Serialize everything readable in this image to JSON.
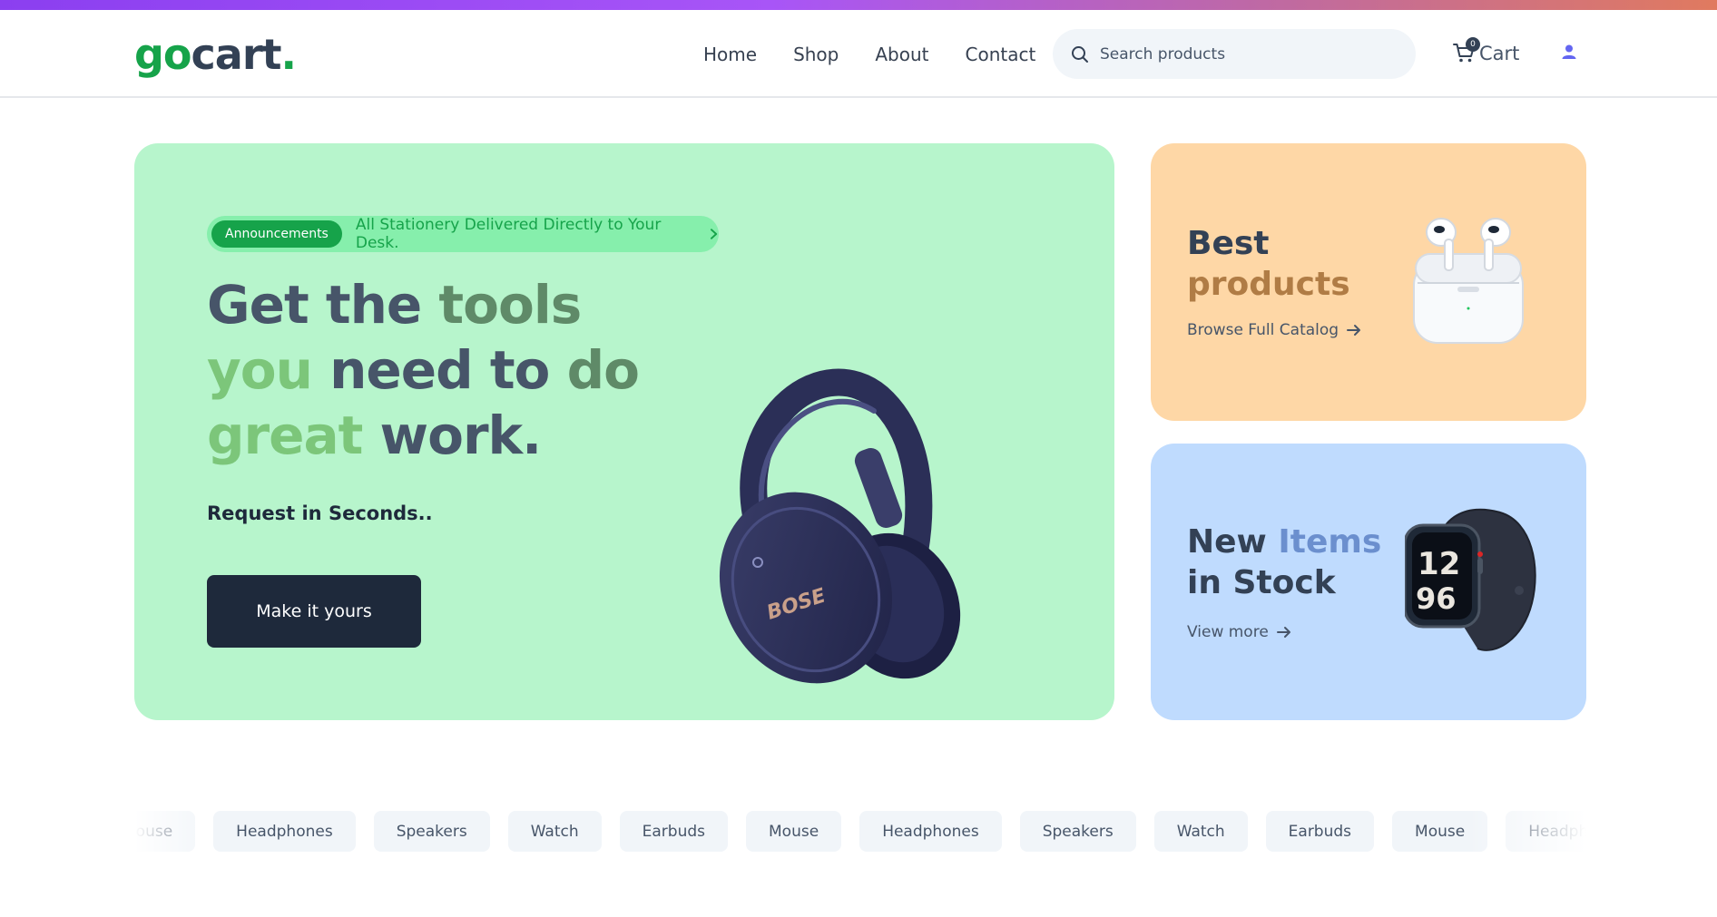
{
  "brand": {
    "logo_go": "go",
    "logo_cart": "cart",
    "logo_dot": ".",
    "accent_color": "#16a34a"
  },
  "nav": {
    "links": [
      "Home",
      "Shop",
      "About",
      "Contact"
    ],
    "search_placeholder": "Search products",
    "cart_label": "Cart",
    "cart_count": "0",
    "icons": {
      "search": "search-icon",
      "cart": "cart-icon",
      "user": "user-icon"
    }
  },
  "hero": {
    "announcement_badge": "Announcements",
    "announcement_text": "All Stationery Delivered Directly to Your Desk.",
    "title_part1": "Get the ",
    "title_part2": "tools ",
    "title_part3": "you",
    "title_part4": " need to ",
    "title_part5": "do ",
    "title_part6": "great",
    "title_part7": " work.",
    "subtitle": "Request in Seconds..",
    "cta_label": "Make it yours",
    "background": "#b7f5cc",
    "image": "headphones-image"
  },
  "cards": {
    "best": {
      "title_a": "Best",
      "title_b": "products",
      "link": "Browse Full Catalog",
      "background": "#fed7a6",
      "image": "earbuds-image"
    },
    "new": {
      "title_a": "New ",
      "title_b": "Items",
      "title_c": " in Stock",
      "link": "View more",
      "background": "#bfdbfe",
      "image": "smartwatch-image"
    }
  },
  "categories": [
    "Mouse",
    "Headphones",
    "Speakers",
    "Watch",
    "Earbuds",
    "Mouse",
    "Headphones",
    "Speakers",
    "Watch",
    "Earbuds",
    "Mouse",
    "Headphones"
  ]
}
